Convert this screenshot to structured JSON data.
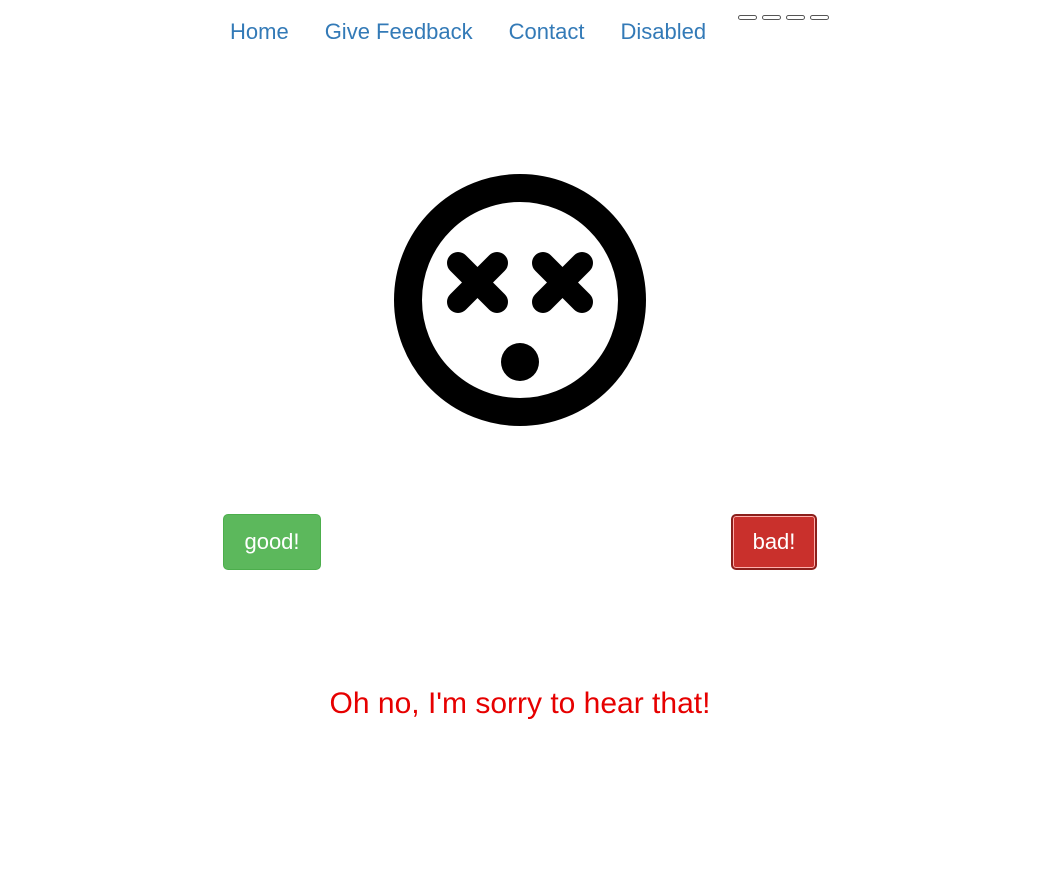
{
  "nav": {
    "items": [
      {
        "label": "Home"
      },
      {
        "label": "Give Feedback"
      },
      {
        "label": "Contact"
      },
      {
        "label": "Disabled"
      }
    ]
  },
  "face": {
    "icon": "dizzy-face-icon",
    "color": "#000000"
  },
  "buttons": {
    "good_label": "good!",
    "bad_label": "bad!",
    "good_color": "#5cb85c",
    "bad_color": "#c9302c"
  },
  "message": {
    "text": "Oh no, I'm sorry to hear that!",
    "color": "#e60000"
  },
  "colors": {
    "link": "#337ab7"
  }
}
